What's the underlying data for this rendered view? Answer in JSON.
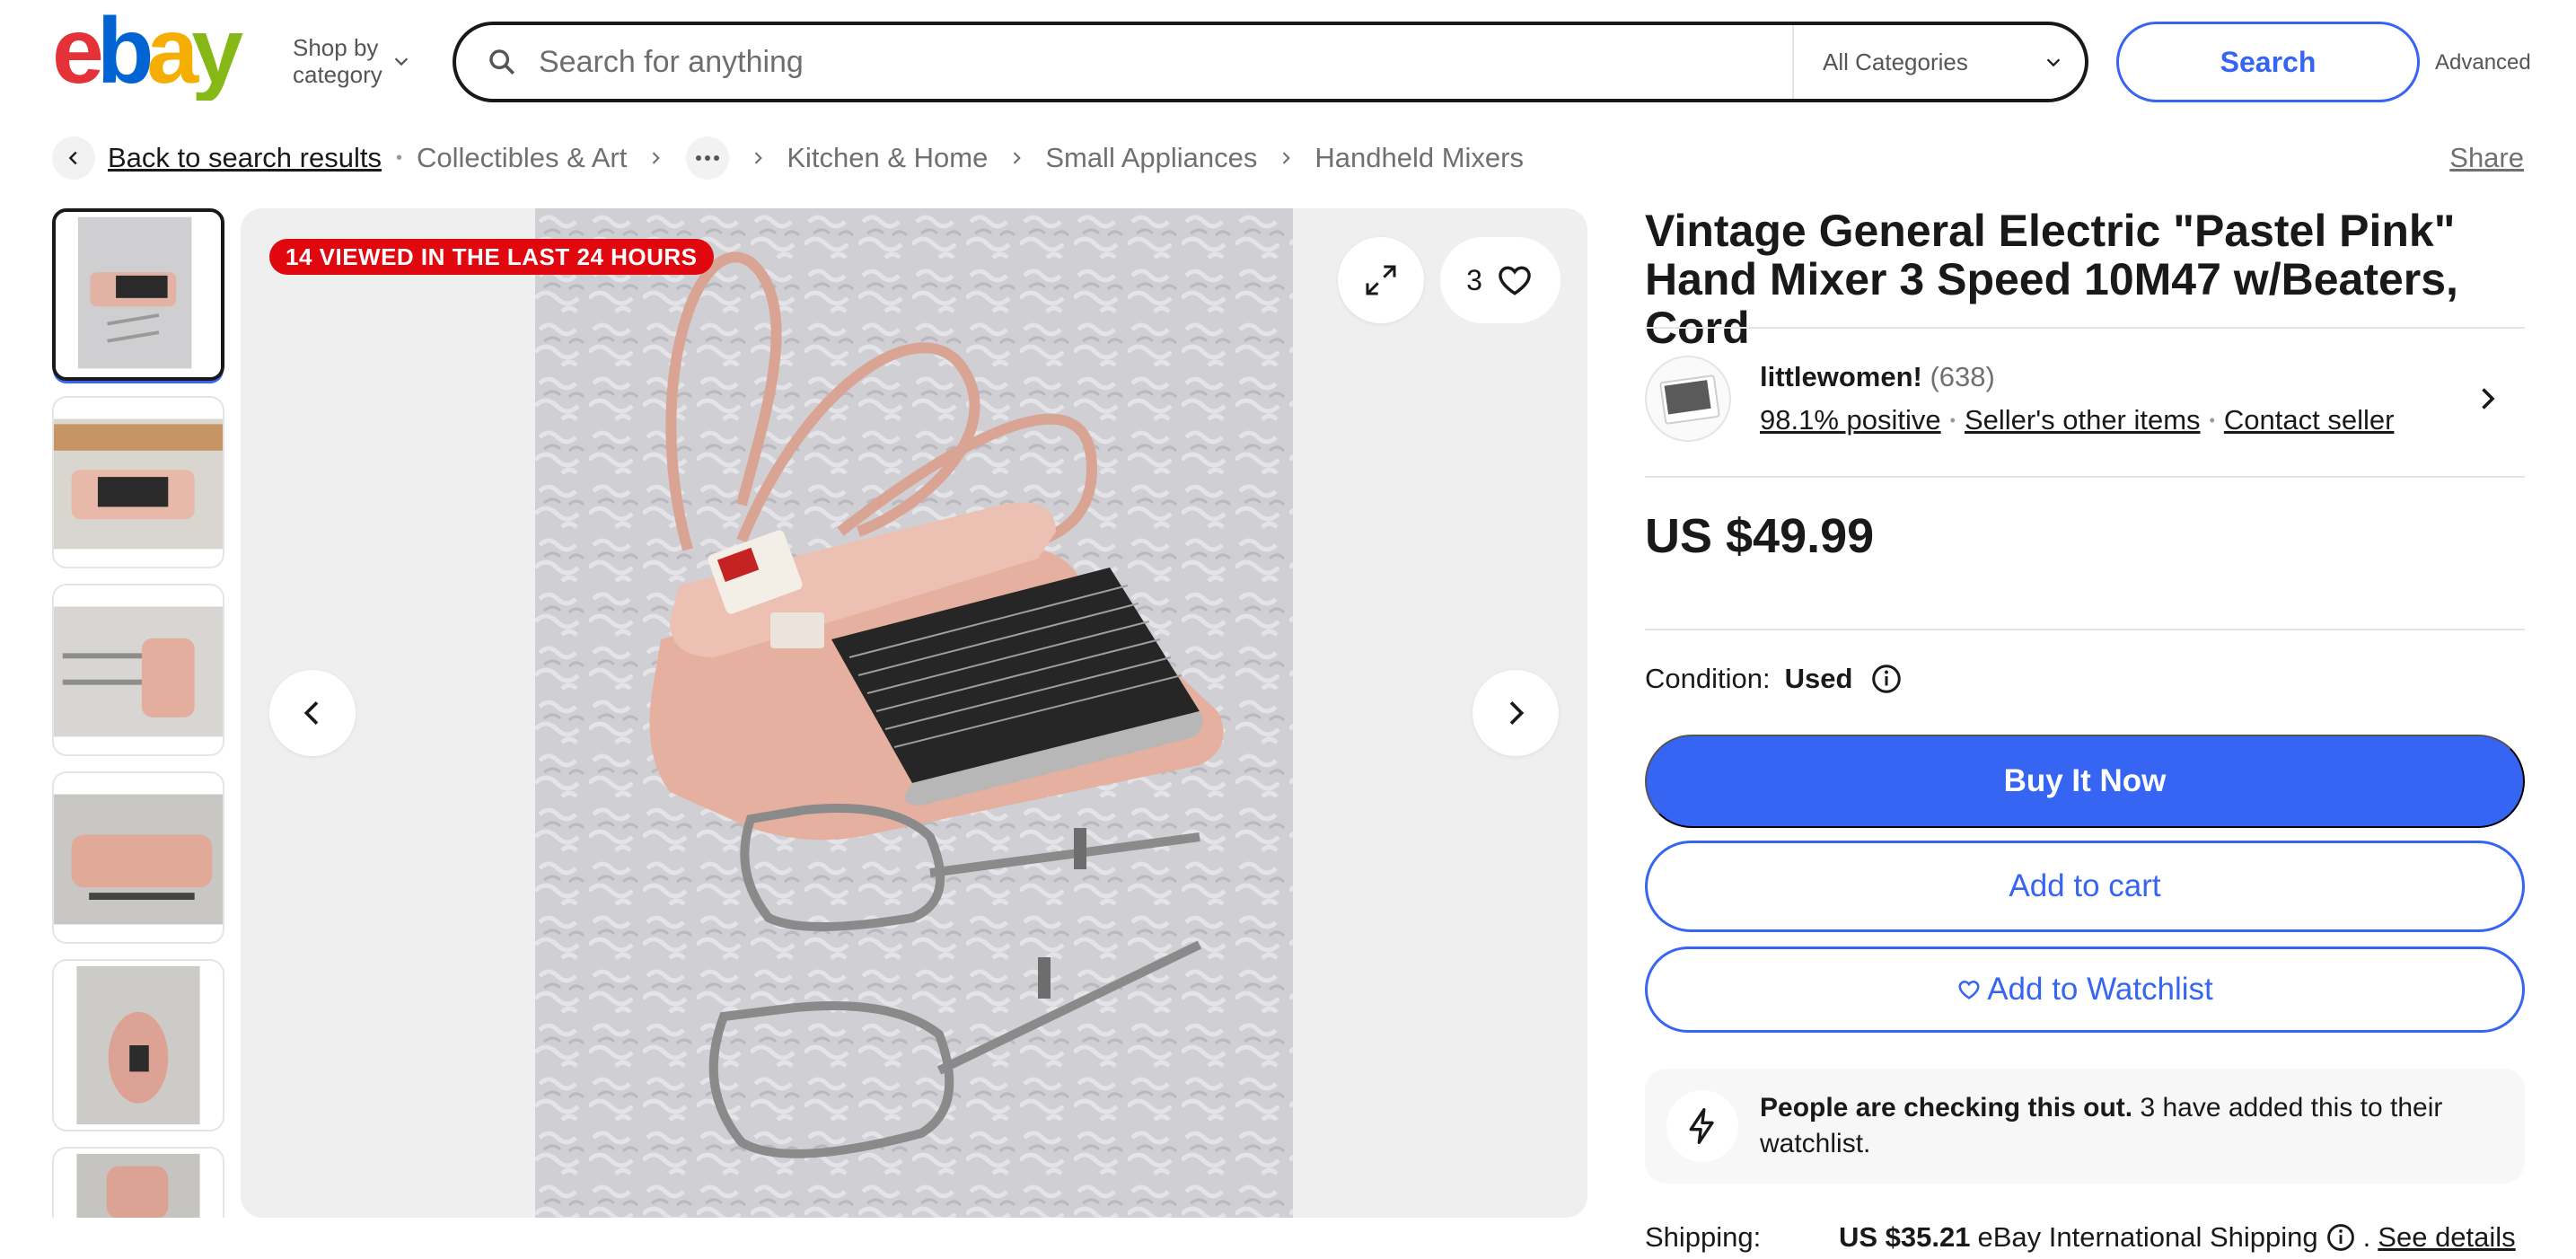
{
  "header": {
    "logo_text": "ebay",
    "shop_by_line1": "Shop by",
    "shop_by_line2": "category",
    "search_placeholder": "Search for anything",
    "category_select": "All Categories",
    "search_button": "Search",
    "advanced_link": "Advanced"
  },
  "breadcrumb": {
    "back": "Back to search results",
    "items": [
      "Collectibles & Art",
      "Kitchen & Home",
      "Small Appliances",
      "Handheld Mixers"
    ],
    "share": "Share"
  },
  "gallery": {
    "badge": "14 VIEWED IN THE LAST 24 HOURS",
    "watch_count": "3",
    "thumbnail_count": 6,
    "active_thumbnail": 1
  },
  "listing": {
    "title": "Vintage General Electric \"Pastel Pink\" Hand Mixer 3 Speed 10M47 w/Beaters, Cord",
    "price": "US $49.99",
    "condition_label": "Condition:",
    "condition_value": "Used"
  },
  "seller": {
    "name": "littlewomen!",
    "feedback_count": "(638)",
    "positive": "98.1% positive",
    "other_items": "Seller's other items",
    "contact": "Contact seller"
  },
  "actions": {
    "buy_now": "Buy It Now",
    "add_to_cart": "Add to cart",
    "add_to_watchlist": "Add to Watchlist"
  },
  "signal": {
    "bold": "People are checking this out.",
    "text": " 3 have added this to their watchlist."
  },
  "shipping": {
    "label": "Shipping:",
    "price": "US $35.21",
    "method": "eBay International Shipping",
    "see_details": "See details"
  },
  "colors": {
    "primary_blue": "#3665f3",
    "badge_red": "#e0070e",
    "logo_red": "#e53238",
    "logo_blue": "#0064d2",
    "logo_yellow": "#f5af02",
    "logo_green": "#86b817",
    "mixer_pink": "#e6b3a6"
  }
}
